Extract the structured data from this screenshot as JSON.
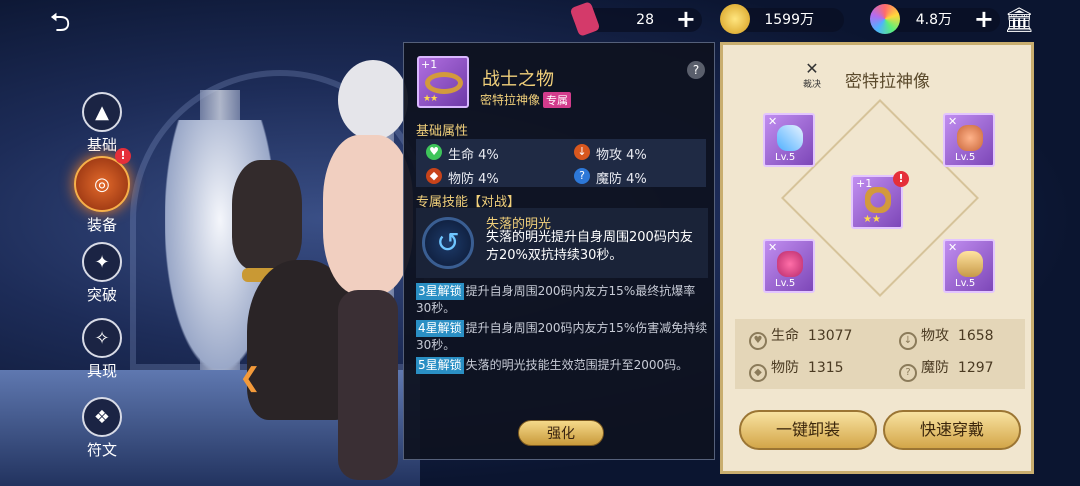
{
  "nav": {
    "items": [
      {
        "label": "基础"
      },
      {
        "label": "装备",
        "badge": "!"
      },
      {
        "label": "突破"
      },
      {
        "label": "具现"
      },
      {
        "label": "符文"
      }
    ]
  },
  "resources": [
    {
      "value": "28",
      "icon": "ticket-icon",
      "color": "#d43a6a"
    },
    {
      "value": "1599万",
      "icon": "gold-coin-icon",
      "color": "#f0c23a"
    },
    {
      "value": "4.8万",
      "icon": "rainbow-gem-icon",
      "color": "#b36cf0"
    }
  ],
  "item": {
    "level": "+1",
    "stars": "★★",
    "name": "战士之物",
    "owner": "密特拉神像",
    "tag": "专属",
    "help": "?",
    "base_title": "基础属性",
    "attrs": [
      {
        "name": "生命",
        "value": "4%"
      },
      {
        "name": "物攻",
        "value": "4%"
      },
      {
        "name": "物防",
        "value": "4%"
      },
      {
        "name": "魔防",
        "value": "4%"
      }
    ],
    "skill_title": "专属技能【对战】",
    "skill_name": "失落的明光",
    "skill_desc": "失落的明光提升自身周围200码内友方20%双抗持续30秒。",
    "unlocks": [
      {
        "badge": "3星解锁",
        "text": "提升自身周围200码内友方15%最终抗爆率30秒。"
      },
      {
        "badge": "4星解锁",
        "text": "提升自身周围200码内友方15%伤害减免持续30秒。"
      },
      {
        "badge": "5星解锁",
        "text": "失落的明光技能生效范围提升至2000码。"
      }
    ],
    "enhance_label": "强化"
  },
  "equip_panel": {
    "badge_text": "裁决",
    "title": "密特拉神像",
    "slots": [
      {
        "lv": "Lv.5",
        "x": "✕",
        "icon": "staff-icon"
      },
      {
        "lv": "Lv.5",
        "x": "✕",
        "icon": "armor-icon"
      },
      {
        "lv": "+1",
        "stars": "★★",
        "icon": "bracelet-icon",
        "badge": "!"
      },
      {
        "lv": "Lv.5",
        "x": "✕",
        "icon": "ring-icon"
      },
      {
        "lv": "Lv.5",
        "x": "✕",
        "icon": "boots-icon"
      }
    ],
    "stats": [
      {
        "name": "生命",
        "value": "13077"
      },
      {
        "name": "物攻",
        "value": "1658"
      },
      {
        "name": "物防",
        "value": "1315"
      },
      {
        "name": "魔防",
        "value": "1297"
      }
    ],
    "btn_unequip": "一键卸装",
    "btn_quick": "快速穿戴"
  }
}
